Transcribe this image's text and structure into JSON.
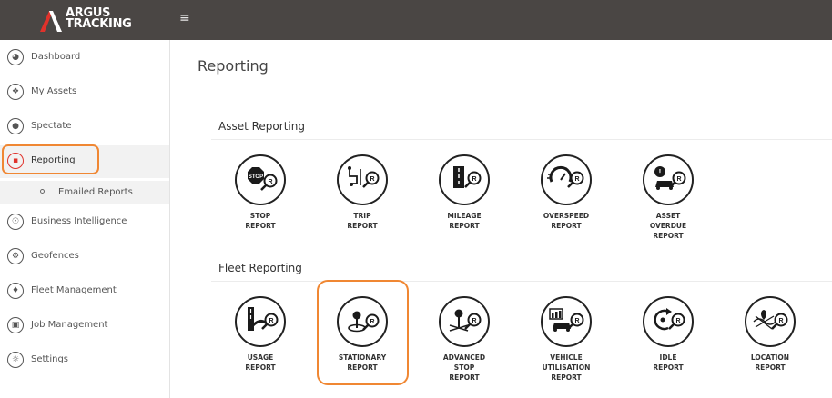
{
  "brand": {
    "line1": "ARGUS",
    "line2": "TRACKING",
    "menu_icon": "hamburger-icon"
  },
  "sidebar": {
    "items": [
      {
        "label": "Dashboard",
        "icon": "dashboard-icon"
      },
      {
        "label": "My Assets",
        "icon": "assets-icon"
      },
      {
        "label": "Spectate",
        "icon": "map-pin-icon"
      },
      {
        "label": "Reporting",
        "icon": "reporting-icon",
        "active": true
      },
      {
        "label": "Business Intelligence",
        "icon": "bulb-icon"
      },
      {
        "label": "Geofences",
        "icon": "geofence-icon"
      },
      {
        "label": "Fleet Management",
        "icon": "car-icon"
      },
      {
        "label": "Job Management",
        "icon": "briefcase-icon"
      },
      {
        "label": "Settings",
        "icon": "gear-icon"
      }
    ],
    "sub_item": {
      "label": "Emailed Reports"
    }
  },
  "main": {
    "title": "Reporting",
    "sections": [
      {
        "title": "Asset Reporting",
        "reports": [
          {
            "line1": "STOP",
            "line2": "REPORT",
            "line3": "",
            "icon": "stop-sign-icon"
          },
          {
            "line1": "TRIP",
            "line2": "REPORT",
            "line3": "",
            "icon": "route-icon"
          },
          {
            "line1": "MILEAGE",
            "line2": "REPORT",
            "line3": "",
            "icon": "road-icon"
          },
          {
            "line1": "OVERSPEED",
            "line2": "REPORT",
            "line3": "",
            "icon": "speedometer-icon"
          },
          {
            "line1": "ASSET",
            "line2": "OVERDUE",
            "line3": "REPORT",
            "icon": "car-alert-icon"
          }
        ]
      },
      {
        "title": "Fleet Reporting",
        "reports": [
          {
            "line1": "USAGE",
            "line2": "REPORT",
            "line3": "",
            "icon": "usage-icon"
          },
          {
            "line1": "STATIONARY",
            "line2": "REPORT",
            "line3": "",
            "icon": "stationary-pin-icon"
          },
          {
            "line1": "ADVANCED",
            "line2": "STOP",
            "line3": "REPORT",
            "icon": "advanced-stop-icon"
          },
          {
            "line1": "VEHICLE",
            "line2": "UTILISATION",
            "line3": "REPORT",
            "icon": "vehicle-chart-icon"
          },
          {
            "line1": "IDLE",
            "line2": "REPORT",
            "line3": "",
            "icon": "idle-cycle-icon"
          },
          {
            "line1": "LOCATION",
            "line2": "REPORT",
            "line3": "",
            "icon": "location-map-icon"
          }
        ]
      }
    ]
  },
  "colors": {
    "topbar": "#4a4644",
    "accent": "#e0322b",
    "highlight": "#f08733"
  }
}
